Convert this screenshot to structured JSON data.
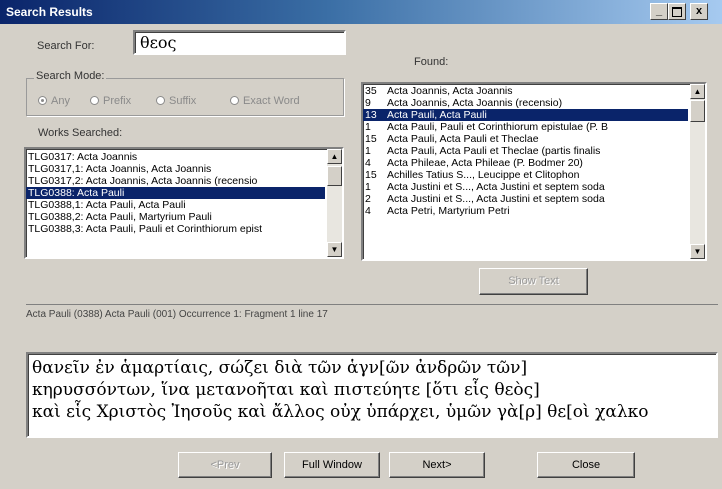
{
  "window": {
    "title": "Search Results"
  },
  "search": {
    "label": "Search For:",
    "value": "θεος"
  },
  "mode": {
    "label": "Search Mode:",
    "options": [
      "Any",
      "Prefix",
      "Suffix",
      "Exact Word"
    ],
    "selected": "Any"
  },
  "works": {
    "label": "Works Searched:",
    "items": [
      "TLG0317: Acta Joannis",
      "TLG0317,1: Acta Joannis, Acta Joannis",
      "TLG0317,2: Acta Joannis, Acta Joannis (recensio",
      "TLG0388: Acta Pauli",
      "TLG0388,1: Acta Pauli, Acta Pauli",
      "TLG0388,2: Acta Pauli, Martyrium Pauli",
      "TLG0388,3: Acta Pauli, Pauli et Corinthiorum epist"
    ],
    "selected_index": 3
  },
  "found": {
    "label": "Found:",
    "items": [
      {
        "count": "35",
        "title": "Acta Joannis, Acta Joannis"
      },
      {
        "count": "9",
        "title": "Acta Joannis, Acta Joannis (recensio)"
      },
      {
        "count": "13",
        "title": "Acta Pauli, Acta Pauli"
      },
      {
        "count": "1",
        "title": "Acta Pauli, Pauli et Corinthiorum epistulae (P. B"
      },
      {
        "count": "15",
        "title": "Acta Pauli, Acta Pauli et Theclae"
      },
      {
        "count": "1",
        "title": "Acta Pauli, Acta Pauli et Theclae (partis finalis"
      },
      {
        "count": "4",
        "title": "Acta Phileae, Acta Phileae (P. Bodmer 20)"
      },
      {
        "count": "15",
        "title": "Achilles Tatius S..., Leucippe et Clitophon"
      },
      {
        "count": "1",
        "title": "Acta Justini et S..., Acta Justini et septem soda"
      },
      {
        "count": "2",
        "title": "Acta Justini et S..., Acta Justini et septem soda"
      },
      {
        "count": "4",
        "title": "Acta Petri, Martyrium Petri"
      }
    ],
    "selected_index": 2
  },
  "buttons": {
    "show_text": "Show Text",
    "prev": "<Prev",
    "full_window": "Full Window",
    "next": "Next>",
    "close": "Close"
  },
  "reference": "Acta Pauli (0388) Acta Pauli  (001) Occurrence 1: Fragment 1 line 17",
  "text_lines": [
    "θανεῖν ἐν ἁμαρτίαις, σώζει διὰ τῶν ἁγν[ῶν ἀνδρῶν τῶν]",
    "κηρυσσόντων, ἵνα μετανοῆται καὶ πιστεύητε [ὅτι εἷς θεὸς]",
    "καὶ εἷς Χριστὸς Ἰησοῦς καὶ ἄλλος οὐχ ὑπάρχει, ὑμῶν γὰ[ρ] θε[οὶ χαλκο"
  ]
}
